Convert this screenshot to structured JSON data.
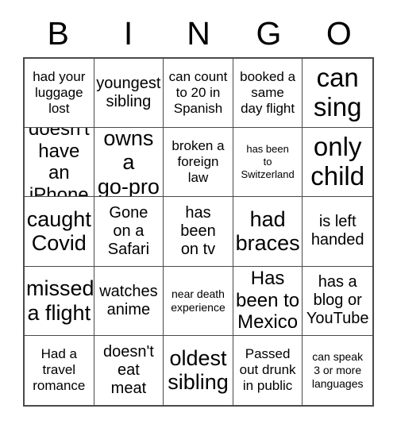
{
  "header": {
    "letters": [
      "B",
      "I",
      "N",
      "G",
      "O"
    ]
  },
  "grid": {
    "rows": 5,
    "columns": 5,
    "border_color": "#4a4a4a",
    "background_color": "#ffffff",
    "text_color": "#000000",
    "cells": [
      {
        "text": "had your\nluggage\nlost",
        "size": "sz-s"
      },
      {
        "text": "youngest\nsibling",
        "size": "sz-m"
      },
      {
        "text": "can count\nto 20 in\nSpanish",
        "size": "sz-s"
      },
      {
        "text": "booked a\nsame\nday flight",
        "size": "sz-s"
      },
      {
        "text": "can\nsing",
        "size": "sz-xxl"
      },
      {
        "text": "doesn't\nhave an\niPhone",
        "size": "sz-l"
      },
      {
        "text": "owns a\ngo-pro",
        "size": "sz-xl"
      },
      {
        "text": "broken a\nforeign\nlaw",
        "size": "sz-s"
      },
      {
        "text": "has been\nto\nSwitzerland",
        "size": "sz-xxs"
      },
      {
        "text": "only\nchild",
        "size": "sz-xxl"
      },
      {
        "text": "caught\nCovid",
        "size": "sz-xl"
      },
      {
        "text": "Gone\non a\nSafari",
        "size": "sz-m"
      },
      {
        "text": "has\nbeen\non tv",
        "size": "sz-m"
      },
      {
        "text": "had\nbraces",
        "size": "sz-xl"
      },
      {
        "text": "is left\nhanded",
        "size": "sz-m"
      },
      {
        "text": "missed\na flight",
        "size": "sz-xl"
      },
      {
        "text": "watches\nanime",
        "size": "sz-m"
      },
      {
        "text": "near death\nexperience",
        "size": "sz-xs"
      },
      {
        "text": "Has\nbeen to\nMexico",
        "size": "sz-l"
      },
      {
        "text": "has a\nblog or\nYouTube",
        "size": "sz-m"
      },
      {
        "text": "Had a\ntravel\nromance",
        "size": "sz-s"
      },
      {
        "text": "doesn't\neat\nmeat",
        "size": "sz-m"
      },
      {
        "text": "oldest\nsibling",
        "size": "sz-xl"
      },
      {
        "text": "Passed\nout drunk\nin public",
        "size": "sz-s"
      },
      {
        "text": "can speak\n3 or more\nlanguages",
        "size": "sz-xs"
      }
    ]
  }
}
